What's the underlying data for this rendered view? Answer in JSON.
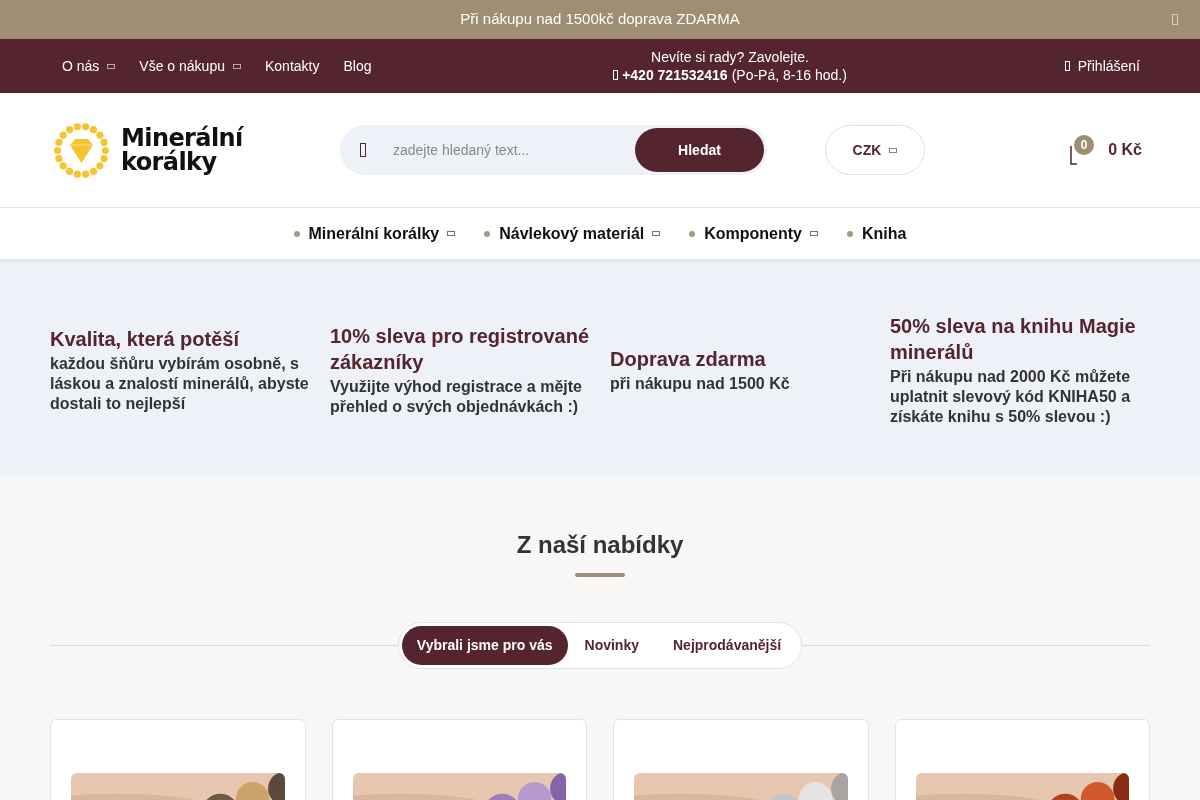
{
  "announcement": {
    "text": "Při nákupu nad 1500kč doprava ZDARMA"
  },
  "top_nav": {
    "links": [
      {
        "label": "O nás",
        "has_dropdown": true
      },
      {
        "label": "Vše o nákupu",
        "has_dropdown": true
      },
      {
        "label": "Kontakty",
        "has_dropdown": false
      },
      {
        "label": "Blog",
        "has_dropdown": false
      }
    ],
    "contact": {
      "prompt": "Nevíte si rady? Zavolejte.",
      "phone": "+420 721532416",
      "hours": "(Po-Pá, 8-16 hod.)"
    },
    "login": "Přihlášení"
  },
  "header": {
    "logo_text": [
      "Minerální",
      "korálky"
    ],
    "search": {
      "placeholder": "zadejte hledaný text...",
      "button": "Hledat"
    },
    "currency": "CZK",
    "cart": {
      "count": "0",
      "total": "0 Kč"
    }
  },
  "main_nav": [
    {
      "label": "Minerální korálky",
      "has_dropdown": true
    },
    {
      "label": "Návlekový materiál",
      "has_dropdown": true
    },
    {
      "label": "Komponenty",
      "has_dropdown": true
    },
    {
      "label": "Kniha",
      "has_dropdown": false
    }
  ],
  "benefits": [
    {
      "title": "Kvalita, která potěší",
      "text": "každou šňůru vybírám osobně, s láskou a znalostí minerálů, abyste dostali to nejlepší"
    },
    {
      "title": "10% sleva pro registrované zákazníky",
      "text": "Využijte výhod registrace a mějte přehled o svých objednávkách :)"
    },
    {
      "title": "Doprava zdarma",
      "text": "při nákupu nad 1500 Kč"
    },
    {
      "title": "50% sleva na knihu Magie minerálů",
      "text": "Při nákupu nad 2000 Kč můžete uplatnit slevový kód KNIHA50 a získáte knihu s 50% slevou :)"
    }
  ],
  "offer": {
    "heading": "Z naší nabídky",
    "tabs": [
      {
        "label": "Vybrali jsme pro vás",
        "selected": true
      },
      {
        "label": "Novinky",
        "selected": false
      },
      {
        "label": "Nejprodávanější",
        "selected": false
      }
    ]
  }
}
